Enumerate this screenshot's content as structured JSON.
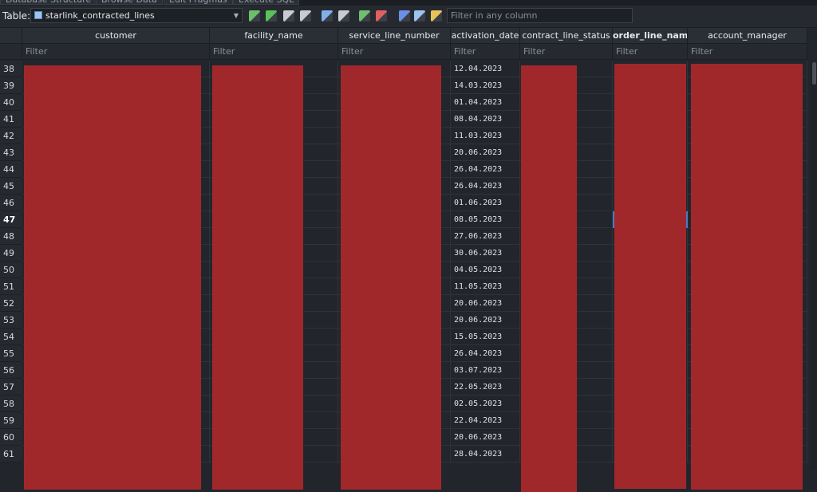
{
  "tabs": [
    "Database Structure",
    "Browse Data",
    "Edit Pragmas",
    "Execute SQL"
  ],
  "toolbar": {
    "table_label": "Table:",
    "table_name": "starlink_contracted_lines",
    "filter_placeholder": "Filter in any column",
    "icons": [
      "create-record-icon",
      "refresh-icon",
      "clear-filters-icon",
      "clear-sorting-icon",
      "save-table-icon",
      "print-icon",
      "insert-values-icon",
      "delete-record-icon",
      "font-icon",
      "find-icon",
      "replace-icon"
    ]
  },
  "columns": [
    "customer",
    "facility_name",
    "service_line_number",
    "activation_date",
    "contract_line_status",
    "order_line_name",
    "account_manager"
  ],
  "filter_placeholder": "Filter",
  "current_row": 47,
  "rows": [
    {
      "num": "38",
      "activation_date": "12.04.2023"
    },
    {
      "num": "39",
      "activation_date": "14.03.2023"
    },
    {
      "num": "40",
      "activation_date": "01.04.2023"
    },
    {
      "num": "41",
      "activation_date": "08.04.2023"
    },
    {
      "num": "42",
      "activation_date": "11.03.2023"
    },
    {
      "num": "43",
      "activation_date": "20.06.2023"
    },
    {
      "num": "44",
      "activation_date": "26.04.2023"
    },
    {
      "num": "45",
      "activation_date": "26.04.2023"
    },
    {
      "num": "46",
      "activation_date": "01.06.2023"
    },
    {
      "num": "47",
      "activation_date": "08.05.2023"
    },
    {
      "num": "48",
      "activation_date": "27.06.2023"
    },
    {
      "num": "49",
      "activation_date": "30.06.2023"
    },
    {
      "num": "50",
      "activation_date": "04.05.2023"
    },
    {
      "num": "51",
      "activation_date": "11.05.2023"
    },
    {
      "num": "52",
      "activation_date": "20.06.2023"
    },
    {
      "num": "53",
      "activation_date": "20.06.2023"
    },
    {
      "num": "54",
      "activation_date": "15.05.2023"
    },
    {
      "num": "55",
      "activation_date": "26.04.2023"
    },
    {
      "num": "56",
      "activation_date": "03.07.2023"
    },
    {
      "num": "57",
      "activation_date": "22.05.2023"
    },
    {
      "num": "58",
      "activation_date": "02.05.2023"
    },
    {
      "num": "59",
      "activation_date": "22.04.2023"
    },
    {
      "num": "60",
      "activation_date": "20.06.2023"
    },
    {
      "num": "61",
      "activation_date": "28.04.2023"
    }
  ],
  "colors": {
    "redaction": "#a0282b",
    "background": "#22262c",
    "header": "#2a2e35"
  }
}
